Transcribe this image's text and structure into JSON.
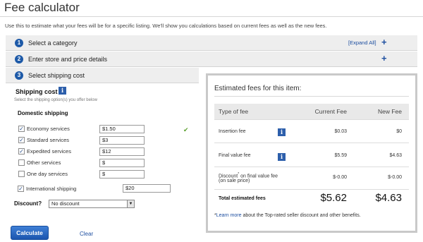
{
  "page": {
    "title": "Fee calculator",
    "intro": "Use this to estimate what your fees will be for a specific listing. We'll show you calculations based on current fees as well as the new fees."
  },
  "steps": [
    {
      "num": "1",
      "label": "Select a category",
      "expand_all": "[Expand All]",
      "plus": "+"
    },
    {
      "num": "2",
      "label": "Enter store and price details",
      "plus": "+"
    },
    {
      "num": "3",
      "label": "Select shipping cost"
    }
  ],
  "shipping": {
    "heading": "Shipping cost",
    "info_icon": "i",
    "subtext": "Select the shipping option(s) you offer below",
    "domestic_heading": "Domestic shipping",
    "services": [
      {
        "label": "Economy services",
        "checked": true,
        "value": "$1.50"
      },
      {
        "label": "Standard services",
        "checked": true,
        "value": "$3"
      },
      {
        "label": "Expedited services",
        "checked": true,
        "value": "$12"
      },
      {
        "label": "Other services",
        "checked": false,
        "value": "$"
      },
      {
        "label": "One day services",
        "checked": false,
        "value": "$"
      }
    ],
    "international": {
      "label": "International shipping",
      "checked": true,
      "value": "$20"
    },
    "valid_mark": "✔"
  },
  "discount": {
    "label": "Discount?",
    "selected": "No discount",
    "arrow": "▼"
  },
  "actions": {
    "calculate": "Calculate",
    "clear": "Clear"
  },
  "estimate": {
    "title": "Estimated fees for this item:",
    "columns": {
      "type": "Type of fee",
      "current": "Current Fee",
      "new": "New Fee"
    },
    "rows": [
      {
        "label": "Insertion fee",
        "current": "$0.03",
        "new": "$0",
        "info": true
      },
      {
        "label": "Final value fee",
        "current": "$5.59",
        "new": "$4.63",
        "info": true
      },
      {
        "label": "Discount",
        "sup": "*",
        "label_rest": " on final value fee",
        "sub": "(on sale price)",
        "current": "$-0.00",
        "new": "$-0.00"
      }
    ],
    "total": {
      "label": "Total estimated fees",
      "current": "$5.62",
      "new": "$4.63"
    },
    "footnote": {
      "star": "*",
      "link": "Learn more",
      "text": " about the Top-rated seller discount and other benefits."
    }
  },
  "colors": {
    "accent": "#1e5aa8",
    "link": "#1e4fa0",
    "valid": "#5aa02c"
  }
}
